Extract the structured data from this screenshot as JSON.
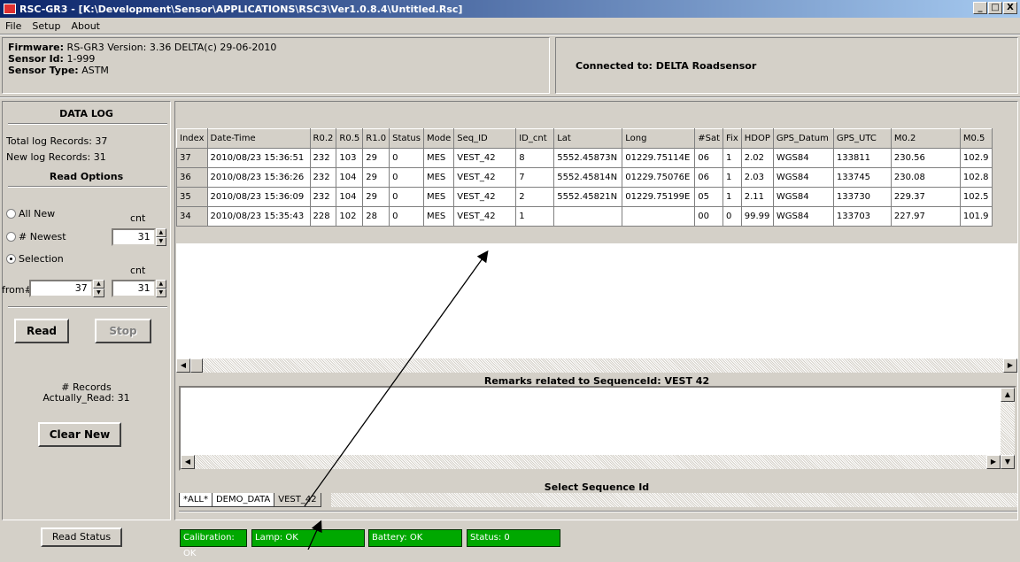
{
  "window": {
    "title": "RSC-GR3 - [K:\\Development\\Sensor\\APPLICATIONS\\RSC3\\Ver1.0.8.4\\Untitled.Rsc]",
    "buttons": [
      "_",
      "□",
      "X"
    ]
  },
  "menu": [
    "File",
    "Setup",
    "About"
  ],
  "info": {
    "firmware_label": "Firmware:",
    "firmware_value": "RS-GR3 Version: 3.36 DELTA(c) 29-06-2010",
    "sensor_id_label": "Sensor Id:",
    "sensor_id_value": "1-999",
    "sensor_type_label": "Sensor Type:",
    "sensor_type_value": "ASTM",
    "connected": "Connected to:  DELTA Roadsensor"
  },
  "datalog": {
    "title": "DATA LOG",
    "total": "Total log Records: 37",
    "new": "New log Records: 31",
    "read_options": "Read Options",
    "opt_all_new": "All New",
    "opt_newest": "# Newest",
    "opt_selection": "Selection",
    "cnt_label": "cnt",
    "cnt2_label": "cnt",
    "newest_cnt": "31",
    "from_label": "from#",
    "from_value": "37",
    "sel_cnt": "31",
    "read_btn": "Read",
    "stop_btn": "Stop",
    "records_label": "# Records",
    "actually_read": "Actually_Read:  31",
    "clear_new_btn": "Clear New"
  },
  "grid": {
    "columns": [
      "Index",
      "Date-Time",
      "R0.2",
      "R0.5",
      "R1.0",
      "Status",
      "Mode",
      "Seq_ID",
      "ID_cnt",
      "Lat",
      "Long",
      "#Sat",
      "Fix",
      "HDOP",
      "GPS_Datum",
      "GPS_UTC",
      "M0.2",
      "M0.5"
    ],
    "rows": [
      [
        "37",
        "2010/08/23 15:36:51",
        "232",
        "103",
        "29",
        "0",
        "MES",
        "VEST_42",
        "8",
        "5552.45873N",
        "01229.75114E",
        "06",
        "1",
        "2.02",
        "WGS84",
        "133811",
        "230.56",
        "102.9"
      ],
      [
        "36",
        "2010/08/23 15:36:26",
        "232",
        "104",
        "29",
        "0",
        "MES",
        "VEST_42",
        "7",
        "5552.45814N",
        "01229.75076E",
        "06",
        "1",
        "2.03",
        "WGS84",
        "133745",
        "230.08",
        "102.8"
      ],
      [
        "35",
        "2010/08/23 15:36:09",
        "232",
        "104",
        "29",
        "0",
        "MES",
        "VEST_42",
        "2",
        "5552.45821N",
        "01229.75199E",
        "05",
        "1",
        "2.11",
        "WGS84",
        "133730",
        "229.37",
        "102.5"
      ],
      [
        "34",
        "2010/08/23 15:35:43",
        "228",
        "102",
        "28",
        "0",
        "MES",
        "VEST_42",
        "1",
        "",
        "",
        "00",
        "0",
        "99.99",
        "WGS84",
        "133703",
        "227.97",
        "101.9"
      ]
    ]
  },
  "remarks_title": "Remarks related to SequenceId: VEST 42",
  "select_seq_title": "Select Sequence Id",
  "seq_tabs": [
    "*ALL*",
    "DEMO_DATA",
    "VEST_42"
  ],
  "status": {
    "read_status_btn": "Read Status",
    "calibration": "Calibration: OK",
    "lamp": "Lamp: OK",
    "battery": "Battery: OK",
    "status": "Status: 0",
    "ok_color": "#00a800"
  }
}
